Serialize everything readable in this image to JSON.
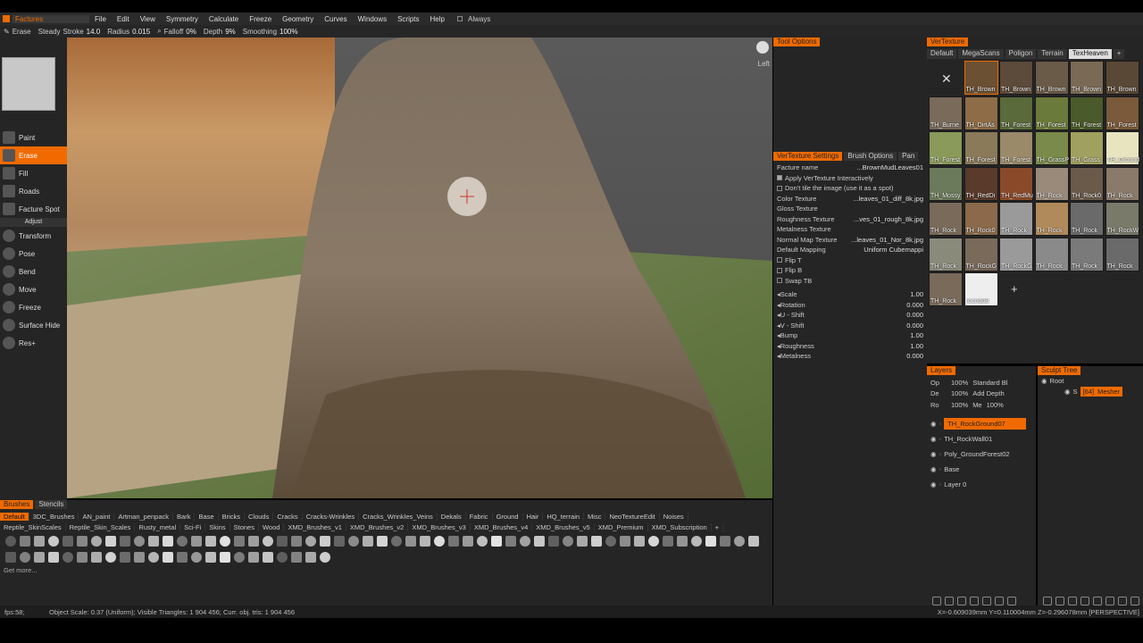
{
  "app": {
    "mode": "Factures",
    "always_label": "Always"
  },
  "menu": [
    "File",
    "Edit",
    "View",
    "Symmetry",
    "Calculate",
    "Freeze",
    "Geometry",
    "Curves",
    "Windows",
    "Scripts",
    "Help"
  ],
  "toolbar": {
    "tool": "Erase",
    "steady_stroke_label": "Steady",
    "stroke_label": "Stroke",
    "stroke_value": "14.0",
    "radius_label": "Radius",
    "radius_value": "0.015",
    "falloff_label": "Falloff",
    "falloff_value": "0%",
    "depth_label": "Depth",
    "depth_value": "9%",
    "smoothing_label": "Smoothing",
    "smoothing_value": "100%"
  },
  "tools": [
    {
      "label": "Paint",
      "icon": "paint-brush-icon",
      "selected": false
    },
    {
      "label": "Erase",
      "icon": "eraser-icon",
      "selected": true
    },
    {
      "label": "Fill",
      "icon": "fill-bucket-icon",
      "selected": false
    },
    {
      "label": "Roads",
      "icon": "roads-icon",
      "selected": false
    },
    {
      "label": "Facture  Spot",
      "icon": "spot-icon",
      "selected": false
    }
  ],
  "adjust_label": "Adjust",
  "adjust_tools": [
    {
      "label": "Transform",
      "icon": "transform-icon"
    },
    {
      "label": "Pose",
      "icon": "pose-icon"
    },
    {
      "label": "Bend",
      "icon": "bend-icon"
    },
    {
      "label": "Move",
      "icon": "move-icon"
    },
    {
      "label": "Freeze",
      "icon": "freeze-icon"
    },
    {
      "label": "Surface  Hide",
      "icon": "surface-hide-icon"
    },
    {
      "label": "Res+",
      "icon": "res-plus-icon"
    }
  ],
  "viewport": {
    "view_label": "Left"
  },
  "tool_options": {
    "title": "Tool  Options"
  },
  "vertexture_settings": {
    "tabs": [
      "VerTexture  Settings",
      "Brush  Options",
      "Pan"
    ],
    "rows": [
      {
        "label": "Facture  name",
        "value": "...BrownMudLeaves01"
      },
      {
        "label": "Apply  VerTexture  Interactively",
        "check": true
      },
      {
        "label": "Don't  tile  the  image  (use  it  as  a  spot)",
        "check": false
      },
      {
        "label": "Color  Texture",
        "value": "...leaves_01_diff_8k.jpg"
      },
      {
        "label": "Gloss  Texture",
        "value": ""
      },
      {
        "label": "Roughness  Texture",
        "value": "...ves_01_rough_8k.jpg"
      },
      {
        "label": "Metalness  Texture",
        "value": ""
      },
      {
        "label": "Normal  Map  Texture",
        "value": "...leaves_01_Nor_8k.jpg"
      },
      {
        "label": "Default  Mapping",
        "value": "Uniform  Cubemappi"
      },
      {
        "label": "Flip  T",
        "check": false
      },
      {
        "label": "Flip  B",
        "check": false
      },
      {
        "label": "Swap  TB",
        "check": false
      }
    ],
    "sliders": [
      {
        "label": "Scale",
        "value": "1.00"
      },
      {
        "label": "Rotation",
        "value": "0.000"
      },
      {
        "label": "U  -  Shift",
        "value": "0.000"
      },
      {
        "label": "V  -  Shift",
        "value": "0.000"
      },
      {
        "label": "Bump",
        "value": "1.00"
      },
      {
        "label": "Roughness",
        "value": "1.00"
      },
      {
        "label": "Metalness",
        "value": "0.000"
      }
    ]
  },
  "vertexture": {
    "title": "VerTexture",
    "tabs": [
      "Default",
      "MegaScans",
      "Poligon",
      "Terrain",
      "TexHeaven"
    ],
    "active_tab": 4,
    "thumbs": [
      "TH_Brown",
      "TH_Brown",
      "TH_Brown",
      "TH_Brown",
      "TH_Brown",
      "TH_Burne",
      "TH_DirtAs",
      "TH_Forest",
      "TH_Forest",
      "TH_Forest",
      "TH_Forest",
      "TH_Forest",
      "TH_Forest",
      "TH_Forest",
      "TH_GrassP",
      "TH_Grass",
      "TH_Ground",
      "TH_Mossy",
      "TH_RedDi",
      "TH_RedMu",
      "TH_Rock",
      "TH_Rock0",
      "TH_Rock",
      "TH_Rock",
      "TH_Rock0",
      "TH_Rock",
      "TH_Rock",
      "TH_Rock",
      "TH_RockW",
      "TH_Rock",
      "TH_RockG",
      "TH_RockG",
      "TH_Rock",
      "TH_Rock",
      "TH_Rock",
      "TH_Rock",
      "round08"
    ]
  },
  "layers": {
    "title": "Layers",
    "props": [
      {
        "label": "Op",
        "value": "100%",
        "extra": "Standard  Bl"
      },
      {
        "label": "De",
        "value": "100%",
        "extra": "Add  Depth"
      },
      {
        "label": "Ro",
        "value": "100%",
        "extra": "Me",
        "extra2": "100%"
      }
    ],
    "items": [
      "TH_RockGround07",
      "TH_RockWall01",
      "Poly_GroundForest02",
      "Base",
      "Layer  0"
    ],
    "selected": 0
  },
  "sculpt_tree": {
    "title": "Sculpt  Tree",
    "root_label": "Root",
    "child_prefix": "S",
    "child_badge": "[64]",
    "child_label": "Mesher"
  },
  "brushes": {
    "tabs": [
      "Brushes",
      "Stencils"
    ],
    "row1": [
      "Default",
      "3DC_Brushes",
      "AN_paint",
      "Artman_penpack",
      "Bark",
      "Base",
      "Bricks",
      "Clouds",
      "Cracks",
      "Cracks-Wrinkles",
      "Cracks_Wrinkles_Veins",
      "Dekals",
      "Fabric",
      "Ground",
      "Hair",
      "HQ_terrain",
      "Misc",
      "NeoTextureEdit",
      "Noises"
    ],
    "row2": [
      "Reptile_SkinScales",
      "Reptile_Skin_Scales",
      "Rusty_metal",
      "Sci-Fi",
      "Skins",
      "Stones",
      "Wood",
      "XMD_Brushes_v1",
      "XMD_Brushes_v2",
      "XMD_Brushes_v3",
      "XMD_Brushes_v4",
      "XMD_Brushes_v5",
      "XMD_Premium",
      "XMD_Subscription"
    ],
    "get_more": "Get  more..."
  },
  "status": {
    "fps": "fps:58;",
    "info": "Object  Scale: 0.37 (Uniform);  Visible  Triangles: 1 904 456;  Curr. obj. tris: 1 904 456",
    "coords": "X=-0.609039mm  Y=0.110004mm  Z=-0.296078mm  [PERSPECTIVE]"
  },
  "colors": {
    "accent": "#f06a00",
    "panel": "#252525"
  }
}
